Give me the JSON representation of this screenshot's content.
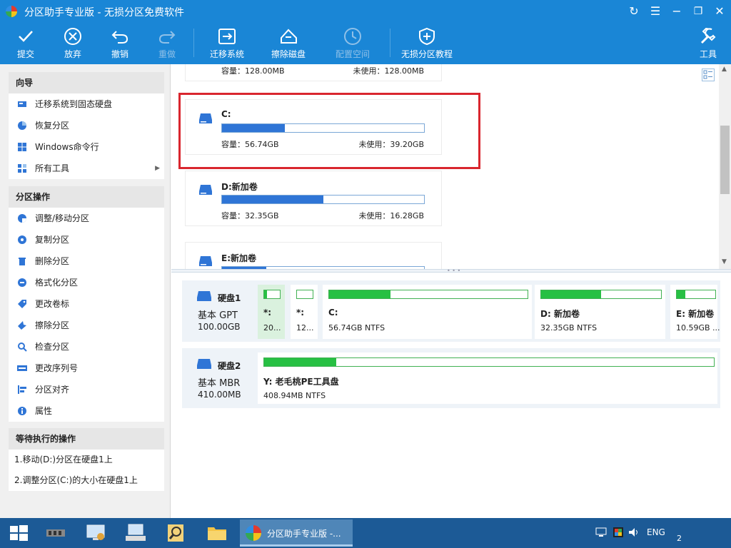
{
  "window": {
    "title": "分区助手专业版 - 无损分区免费软件",
    "controls": {
      "refresh": "↻",
      "menu": "☰",
      "minimize": "−",
      "restore": "❐",
      "close": "✕"
    }
  },
  "toolbar": {
    "commit": "提交",
    "discard": "放弃",
    "undo": "撤销",
    "redo": "重做",
    "migrate_os": "迁移系统",
    "wipe_disk": "擦除磁盘",
    "config_space": "配置空间",
    "tutorial": "无损分区教程",
    "tools": "工具"
  },
  "sidebar": {
    "wizard": {
      "title": "向导",
      "items": [
        {
          "label": "迁移系统到固态硬盘",
          "icon": "migrate-ssd-icon"
        },
        {
          "label": "恢复分区",
          "icon": "recover-partition-icon"
        },
        {
          "label": "Windows命令行",
          "icon": "windows-icon"
        },
        {
          "label": "所有工具",
          "icon": "all-tools-icon",
          "submenu": "▶"
        }
      ]
    },
    "partition_ops": {
      "title": "分区操作",
      "items": [
        {
          "label": "调整/移动分区",
          "icon": "resize-partition-icon"
        },
        {
          "label": "复制分区",
          "icon": "copy-partition-icon"
        },
        {
          "label": "删除分区",
          "icon": "delete-icon"
        },
        {
          "label": "格式化分区",
          "icon": "format-icon"
        },
        {
          "label": "更改卷标",
          "icon": "label-tag-icon"
        },
        {
          "label": "擦除分区",
          "icon": "wipe-icon"
        },
        {
          "label": "检查分区",
          "icon": "search-icon"
        },
        {
          "label": "更改序列号",
          "icon": "serial-number-icon"
        },
        {
          "label": "分区对齐",
          "icon": "align-icon"
        },
        {
          "label": "属性",
          "icon": "info-icon"
        }
      ]
    },
    "pending": {
      "title": "等待执行的操作",
      "items": [
        "1.移动(D:)分区在硬盘1上",
        "2.调整分区(C:)的大小在硬盘1上"
      ]
    }
  },
  "partition_cards": [
    {
      "name": "",
      "capacity": "容量：128.00MB",
      "free": "未使用：128.00MB",
      "used_fraction": 0.0
    },
    {
      "name": "C:",
      "capacity": "容量：56.74GB",
      "free": "未使用：39.20GB",
      "used_fraction": 0.31
    },
    {
      "name": "D:新加卷",
      "capacity": "容量：32.35GB",
      "free": "未使用：16.28GB",
      "used_fraction": 0.5
    },
    {
      "name": "E:新加卷",
      "capacity": "",
      "free": "",
      "used_fraction": 0.22
    }
  ],
  "disks": [
    {
      "name": "硬盘1",
      "type": "基本 GPT",
      "size": "100.00GB",
      "partitions": [
        {
          "name": "*:",
          "info": "20...",
          "used_fraction": 0.2,
          "selected": true
        },
        {
          "name": "*:",
          "info": "12...",
          "used_fraction": 0.0,
          "selected": false
        },
        {
          "name": "C:",
          "info": "56.74GB NTFS",
          "used_fraction": 0.31,
          "selected": false
        },
        {
          "name": "D: 新加卷",
          "info": "32.35GB NTFS",
          "used_fraction": 0.5,
          "selected": false
        },
        {
          "name": "E: 新加卷",
          "info": "10.59GB ...",
          "used_fraction": 0.22,
          "selected": false
        }
      ]
    },
    {
      "name": "硬盘2",
      "type": "基本 MBR",
      "size": "410.00MB",
      "partitions": [
        {
          "name": "Y: 老毛桃PE工具盘",
          "info": "408.94MB NTFS",
          "used_fraction": 0.16,
          "selected": false
        }
      ]
    }
  ],
  "taskbar": {
    "active_task": "分区助手专业版 -...",
    "language": "ENG",
    "clock_fragment": "2"
  },
  "colors": {
    "accent": "#1a86d6",
    "highlight_box": "#d9262e",
    "usage_blue": "#2f75d6",
    "usage_green": "#27c043"
  }
}
